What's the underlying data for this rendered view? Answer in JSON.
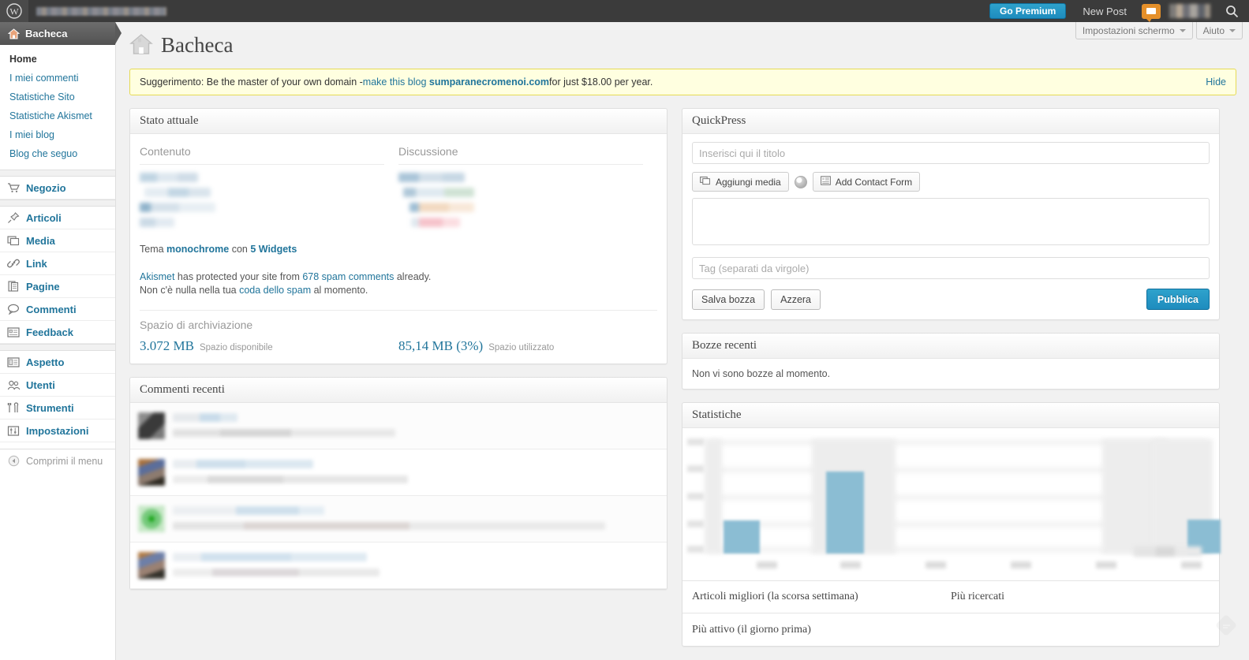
{
  "adminbar": {
    "wp_logo_icon": "wordpress-logo-icon",
    "sitename_redacted": true,
    "go_premium_label": "Go Premium",
    "new_post_label": "New Post",
    "comments_bubble_icon": "comment-bubble-icon",
    "avatar_redacted": true,
    "search_icon": "search-icon"
  },
  "sidebar": {
    "current": {
      "label": "Bacheca",
      "icon": "dashboard-home-icon"
    },
    "submenu": [
      {
        "label": "Home",
        "current": true
      },
      {
        "label": "I miei commenti",
        "current": false
      },
      {
        "label": "Statistiche Sito",
        "current": false
      },
      {
        "label": "Statistiche Akismet",
        "current": false
      },
      {
        "label": "I miei blog",
        "current": false
      },
      {
        "label": "Blog che seguo",
        "current": false
      }
    ],
    "items": [
      {
        "label": "Negozio",
        "icon": "cart-icon"
      },
      {
        "label": "Articoli",
        "icon": "pin-icon"
      },
      {
        "label": "Media",
        "icon": "media-icon"
      },
      {
        "label": "Link",
        "icon": "link-icon"
      },
      {
        "label": "Pagine",
        "icon": "pages-icon"
      },
      {
        "label": "Commenti",
        "icon": "comment-icon"
      },
      {
        "label": "Feedback",
        "icon": "feedback-icon"
      },
      {
        "label": "Aspetto",
        "icon": "appearance-icon"
      },
      {
        "label": "Utenti",
        "icon": "users-icon"
      },
      {
        "label": "Strumenti",
        "icon": "tools-icon"
      },
      {
        "label": "Impostazioni",
        "icon": "settings-icon"
      }
    ],
    "collapse_label": "Comprimi il menu",
    "collapse_icon": "collapse-arrow-icon"
  },
  "screen_meta": {
    "screen_options_label": "Impostazioni schermo",
    "help_label": "Aiuto"
  },
  "page": {
    "title": "Bacheca",
    "title_icon": "house-icon"
  },
  "notice": {
    "prefix": "Suggerimento: Be the master of your own domain - ",
    "link_text": "make this blog",
    "domain": "sumparanecromenoi.com",
    "suffix": " for just $18.00 per year.",
    "hide_label": "Hide"
  },
  "right_now": {
    "panel_title": "Stato attuale",
    "col_content_title": "Contenuto",
    "col_discussion_title": "Discussione",
    "content_rows_redacted": 4,
    "discussion_rows_redacted": 4,
    "theme_prefix": "Tema ",
    "theme_name": "monochrome",
    "theme_mid": " con ",
    "widgets_label": "5 Widgets",
    "akismet_link": "Akismet",
    "akismet_mid": " has protected your site from ",
    "akismet_count": "678 spam comments",
    "akismet_suffix": " already.",
    "spam_queue_prefix": "Non c'è nulla nella tua ",
    "spam_queue_link": "coda dello spam",
    "spam_queue_suffix": " al momento.",
    "storage_title": "Spazio di archiviazione",
    "storage_available_value": "3.072 MB",
    "storage_available_label": "Spazio disponibile",
    "storage_used_value": "85,14 MB (3%)",
    "storage_used_label": "Spazio utilizzato"
  },
  "recent_comments": {
    "panel_title": "Commenti recenti",
    "rows": [
      {
        "avatar_style": "dark-gray",
        "redacted": true
      },
      {
        "avatar_style": "blue-brown",
        "redacted": true
      },
      {
        "avatar_style": "green",
        "redacted": true
      },
      {
        "avatar_style": "blue-brown-2",
        "redacted": true
      }
    ]
  },
  "quickpress": {
    "panel_title": "QuickPress",
    "title_placeholder": "Inserisci qui il titolo",
    "title_value": "",
    "add_media_label": "Aggiungi media",
    "add_media_icon": "add-media-icon",
    "media_circle_icon": "media-circle-icon",
    "add_contact_form_label": "Add Contact Form",
    "add_contact_form_icon": "contact-form-icon",
    "content_value": "",
    "tags_placeholder": "Tag (separati da virgole)",
    "tags_value": "",
    "save_draft_label": "Salva bozza",
    "reset_label": "Azzera",
    "publish_label": "Pubblica"
  },
  "recent_drafts": {
    "panel_title": "Bozze recenti",
    "empty_text": "Non vi sono bozze al momento."
  },
  "stats": {
    "panel_title": "Statistiche",
    "top_posts_label": "Articoli migliori (la scorsa settimana)",
    "most_searched_label": "Più ricercati",
    "most_active_label": "Più attivo (il giorno prima)"
  },
  "chart_data": {
    "type": "bar",
    "title": "Statistiche",
    "xlabel": "",
    "ylabel": "",
    "labels_redacted": true,
    "categories": [
      "",
      "",
      "",
      "",
      "",
      "",
      ""
    ],
    "values": [
      0,
      29,
      0,
      72,
      0,
      0,
      0,
      30
    ],
    "ylim": [
      0,
      100
    ],
    "grid": true,
    "legend_position": "bottom-right",
    "bar_color": "#8bbdd3",
    "note": "Axis tick labels and legend are blurred/redacted in the source screenshot; bar heights estimated from pixels."
  },
  "colors": {
    "accent_blue": "#21759b",
    "button_blue": "#1e8cbe",
    "bar_blue": "#8bbdd3",
    "notice_bg": "#ffffe0",
    "notice_border": "#e6db55",
    "adminbar_bg": "#3b3b3b",
    "bubble_orange": "#e5902a"
  }
}
